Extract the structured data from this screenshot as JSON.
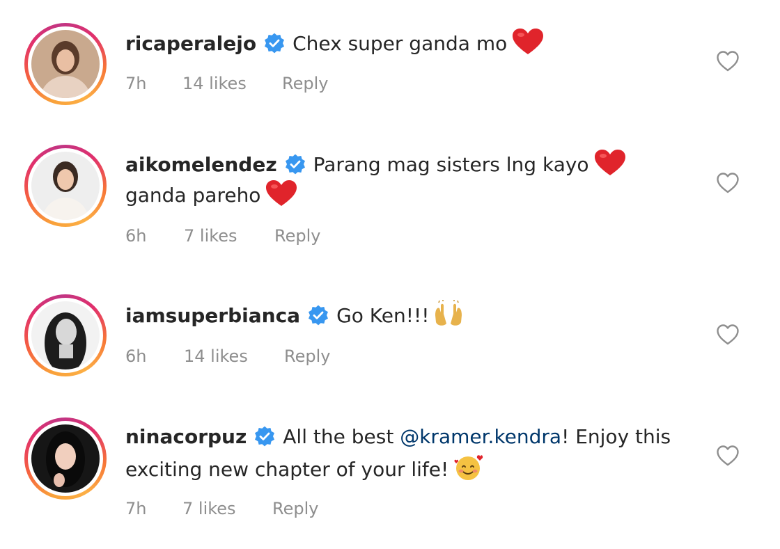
{
  "comments": [
    {
      "username": "ricaperalejo",
      "text": "Chex super ganda mo",
      "time": "7h",
      "likes": "14 likes",
      "reply": "Reply"
    },
    {
      "username": "aikomelendez",
      "text_line1": "Parang mag sisters lng kayo",
      "text_line2": "ganda pareho",
      "time": "6h",
      "likes": "7 likes",
      "reply": "Reply"
    },
    {
      "username": "iamsuperbianca",
      "text": "Go Ken!!!",
      "time": "6h",
      "likes": "14 likes",
      "reply": "Reply"
    },
    {
      "username": "ninacorpuz",
      "text_pre": "All the best",
      "mention": "@kramer.kendra",
      "text_post": "! Enjoy this",
      "text_line2": "exciting new chapter of your life!",
      "time": "7h",
      "likes": "7 likes",
      "reply": "Reply"
    }
  ],
  "icons": {
    "verified": "verified-badge-icon",
    "heart_emoji": "red-heart-emoji",
    "raised_hands": "raised-hands-emoji",
    "smiling_hearts": "smiling-face-with-hearts-emoji",
    "like": "heart-outline-icon"
  },
  "colors": {
    "verified_blue": "#3897f0",
    "meta_gray": "#8e8e8e",
    "mention_blue": "#00376b",
    "heart_red": "#e0242b"
  }
}
